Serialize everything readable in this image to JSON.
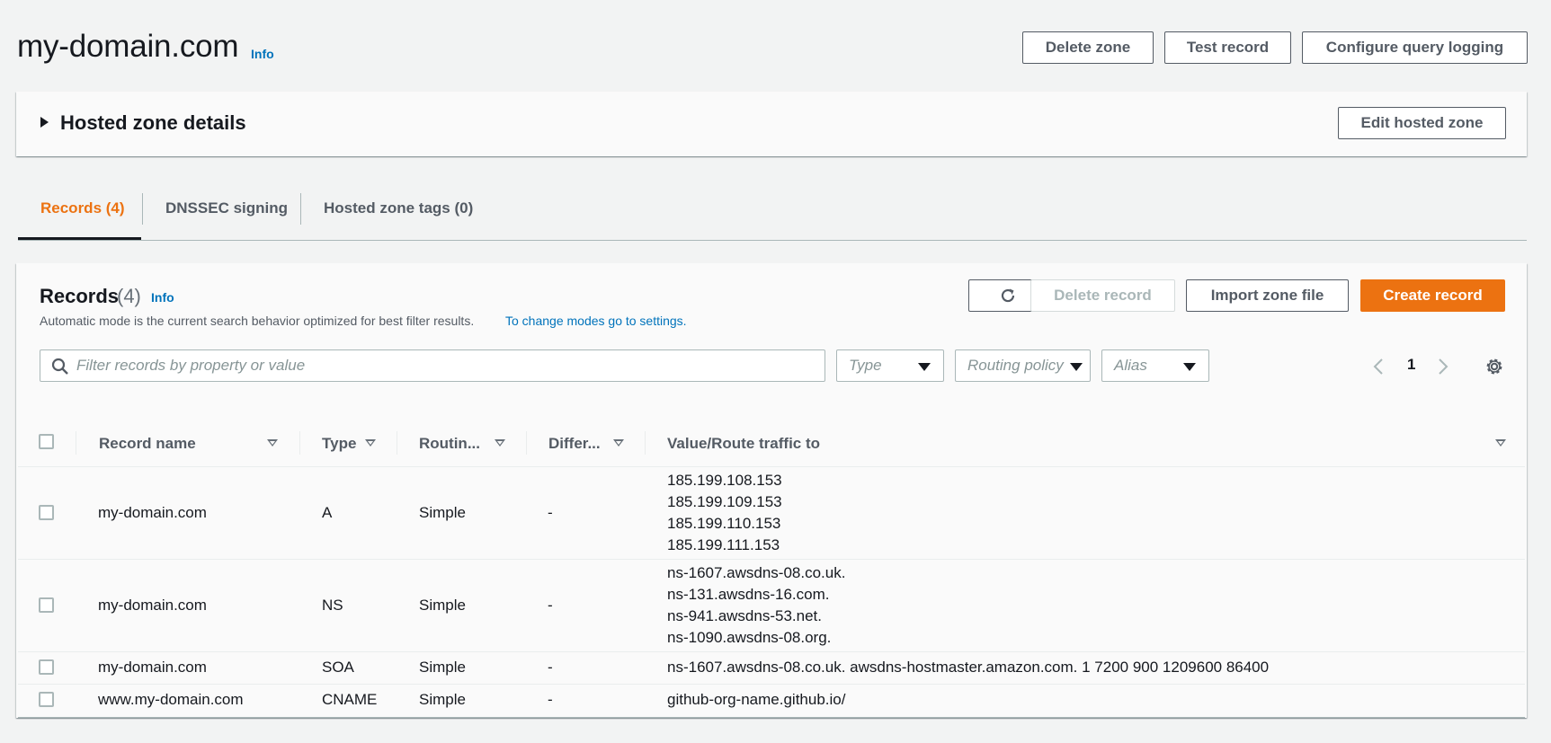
{
  "header": {
    "title": "my-domain.com",
    "info": "Info",
    "buttons": {
      "delete_zone": "Delete zone",
      "test_record": "Test record",
      "configure_query_logging": "Configure query logging"
    }
  },
  "hosted_zone": {
    "title": "Hosted zone details",
    "edit_button": "Edit hosted zone"
  },
  "tabs": [
    {
      "label": "Records (4)",
      "active": true
    },
    {
      "label": "DNSSEC signing",
      "active": false
    },
    {
      "label": "Hosted zone tags (0)",
      "active": false
    }
  ],
  "records_panel": {
    "title": "Records",
    "count": "(4)",
    "info": "Info",
    "description": "Automatic mode is the current search behavior optimized for best filter results.",
    "description_link": "To change modes go to settings.",
    "buttons": {
      "delete_record": "Delete record",
      "import_zone_file": "Import zone file",
      "create_record": "Create record"
    },
    "search_placeholder": "Filter records by property or value",
    "filters": {
      "type": "Type",
      "routing_policy": "Routing policy",
      "alias": "Alias"
    },
    "pagination": {
      "page": "1"
    }
  },
  "table": {
    "columns": {
      "record_name": "Record name",
      "type": "Type",
      "routing": "Routin...",
      "differ": "Differ...",
      "value": "Value/Route traffic to"
    },
    "rows": [
      {
        "name": "my-domain.com",
        "type": "A",
        "routing": "Simple",
        "differ": "-",
        "values": [
          "185.199.108.153",
          "185.199.109.153",
          "185.199.110.153",
          "185.199.111.153"
        ]
      },
      {
        "name": "my-domain.com",
        "type": "NS",
        "routing": "Simple",
        "differ": "-",
        "values": [
          "ns-1607.awsdns-08.co.uk.",
          "ns-131.awsdns-16.com.",
          "ns-941.awsdns-53.net.",
          "ns-1090.awsdns-08.org."
        ]
      },
      {
        "name": "my-domain.com",
        "type": "SOA",
        "routing": "Simple",
        "differ": "-",
        "values": [
          "ns-1607.awsdns-08.co.uk. awsdns-hostmaster.amazon.com. 1 7200 900 1209600 86400"
        ]
      },
      {
        "name": "www.my-domain.com",
        "type": "CNAME",
        "routing": "Simple",
        "differ": "-",
        "values": [
          "github-org-name.github.io/"
        ]
      }
    ]
  },
  "colors": {
    "accent": "#ec7211",
    "link": "#0073bb",
    "text": "#16191f",
    "muted": "#545b64",
    "background": "#f2f3f3"
  }
}
